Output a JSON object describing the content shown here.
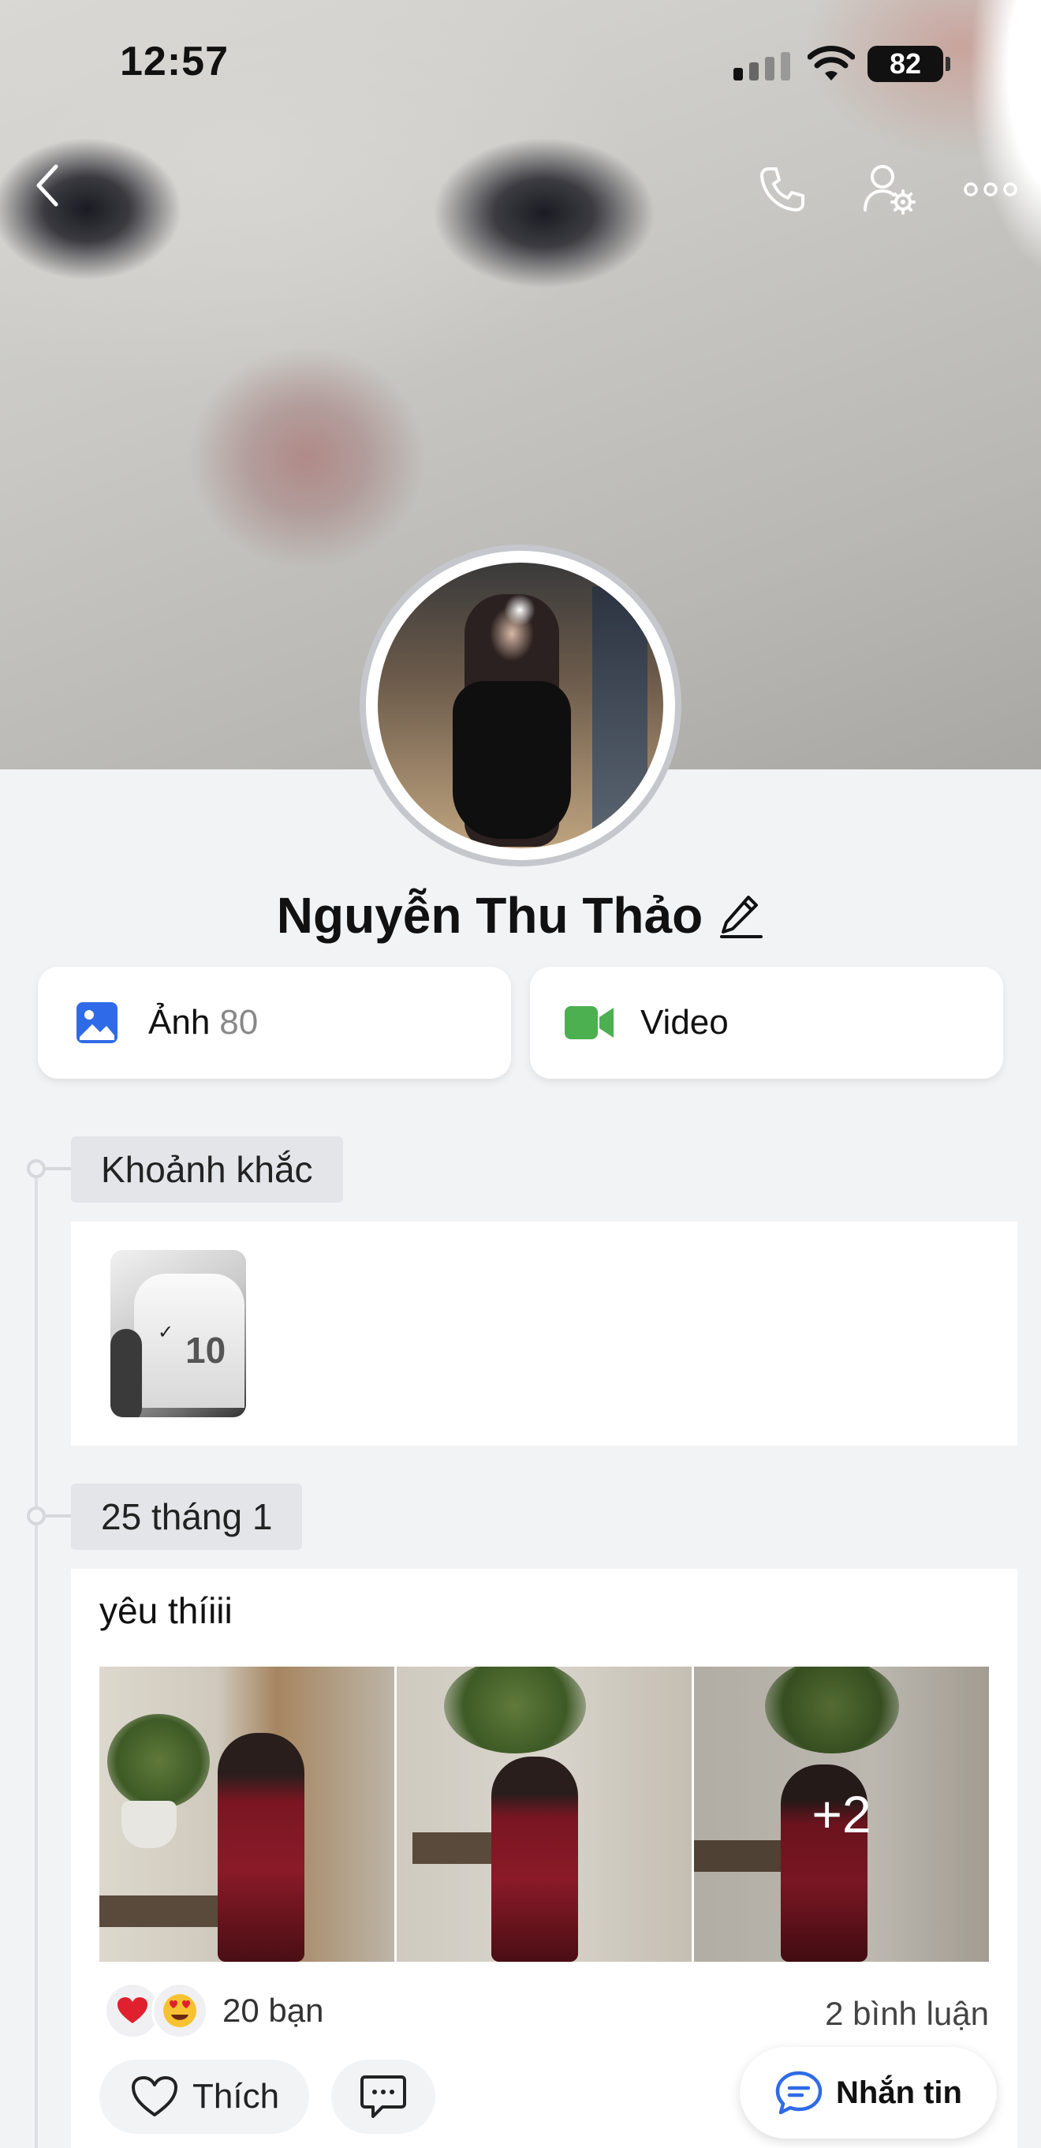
{
  "status_bar": {
    "time": "12:57",
    "battery": "82"
  },
  "profile": {
    "name": "Nguyễn Thu Thảo"
  },
  "media": {
    "photos_label": "Ảnh",
    "photos_count": "80",
    "video_label": "Video"
  },
  "timeline": {
    "moments_tag": "Khoảnh khắc",
    "post_date_tag": "25 tháng 1",
    "post": {
      "text": "yêu thíiii",
      "more_photos": "+2",
      "reactions_count": "20 bạn",
      "comments_count": "2 bình luận",
      "like_label": "Thích"
    }
  },
  "fab": {
    "message_label": "Nhắn tin"
  },
  "icons": {
    "back": "chevron-left-icon",
    "call": "phone-icon",
    "settings": "user-gear-icon",
    "more": "more-dots-icon",
    "edit": "pencil-icon",
    "photo": "image-icon",
    "video": "video-camera-icon",
    "heart_reaction": "heart-emoji",
    "love_reaction": "heart-eyes-emoji",
    "like": "heart-outline-icon",
    "comment": "comment-icon",
    "chat": "chat-bubble-icon"
  },
  "colors": {
    "photo_icon": "#2f6be8",
    "video_icon": "#4caf50",
    "chat_icon": "#2f6be8",
    "background": "#f2f3f5"
  }
}
